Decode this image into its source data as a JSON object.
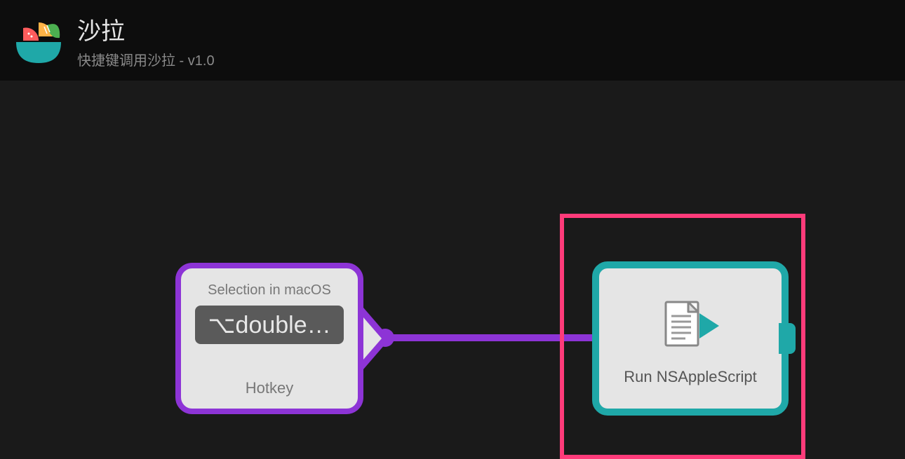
{
  "header": {
    "title": "沙拉",
    "subtitle": "快捷键调用沙拉 - v1.0"
  },
  "hotkey_node": {
    "top_label": "Selection in macOS",
    "key_display": "⌥double…",
    "bottom_label": "Hotkey"
  },
  "script_node": {
    "label": "Run NSAppleScript"
  },
  "colors": {
    "hotkey_border": "#8d34d6",
    "script_border": "#1fa8a8",
    "selection_border": "#ff3b7a"
  }
}
